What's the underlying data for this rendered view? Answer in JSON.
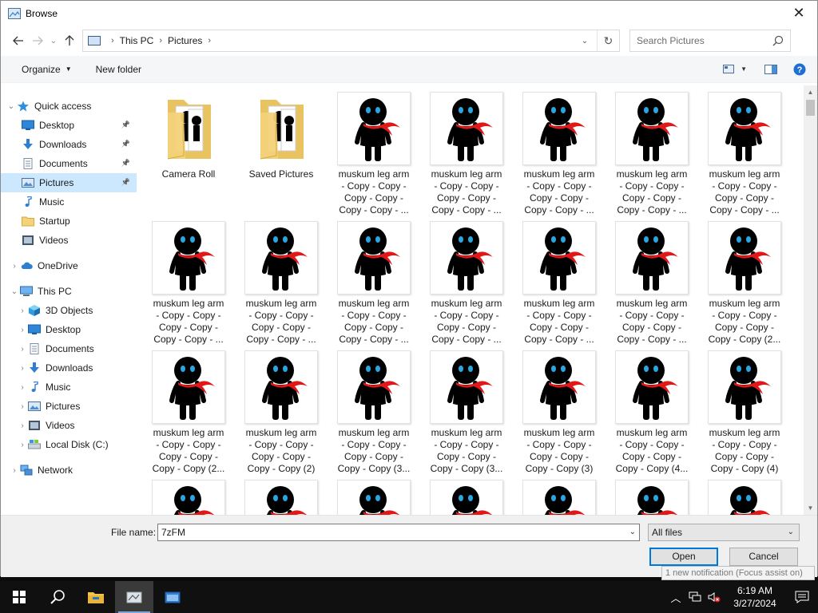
{
  "dialog": {
    "title": "Browse",
    "close_label": "✕"
  },
  "address": {
    "crumbs": [
      "This PC",
      "Pictures"
    ],
    "search_placeholder": "Search Pictures"
  },
  "toolbar": {
    "organize_label": "Organize",
    "new_folder_label": "New folder"
  },
  "nav": {
    "items": [
      {
        "label": "Quick access",
        "icon": "star-icon"
      },
      {
        "label": "Desktop",
        "icon": "desktop-icon"
      },
      {
        "label": "Downloads",
        "icon": "download-icon"
      },
      {
        "label": "Documents",
        "icon": "documents-icon"
      },
      {
        "label": "Pictures",
        "icon": "pictures-icon"
      },
      {
        "label": "Music",
        "icon": "music-icon"
      },
      {
        "label": "Startup",
        "icon": "folder-icon"
      },
      {
        "label": "Videos",
        "icon": "videos-icon"
      },
      {
        "label": "OneDrive",
        "icon": "cloud-icon"
      },
      {
        "label": "This PC",
        "icon": "computer-icon"
      },
      {
        "label": "3D Objects",
        "icon": "cube-icon"
      },
      {
        "label": "Desktop",
        "icon": "desktop-icon"
      },
      {
        "label": "Documents",
        "icon": "documents-icon"
      },
      {
        "label": "Downloads",
        "icon": "download-icon"
      },
      {
        "label": "Music",
        "icon": "music-icon"
      },
      {
        "label": "Pictures",
        "icon": "pictures-icon"
      },
      {
        "label": "Videos",
        "icon": "videos-icon"
      },
      {
        "label": "Local Disk (C:)",
        "icon": "drive-icon"
      },
      {
        "label": "Network",
        "icon": "network-icon"
      }
    ]
  },
  "files": {
    "items": [
      {
        "type": "folder",
        "name": [
          "Camera Roll"
        ]
      },
      {
        "type": "folder",
        "name": [
          "Saved Pictures"
        ]
      },
      {
        "type": "image",
        "name": [
          "muskum leg arm",
          "- Copy - Copy -",
          "Copy - Copy -",
          "Copy - Copy - ..."
        ]
      },
      {
        "type": "image",
        "name": [
          "muskum leg arm",
          "- Copy - Copy -",
          "Copy - Copy -",
          "Copy - Copy - ..."
        ]
      },
      {
        "type": "image",
        "name": [
          "muskum leg arm",
          "- Copy - Copy -",
          "Copy - Copy -",
          "Copy - Copy - ..."
        ]
      },
      {
        "type": "image",
        "name": [
          "muskum leg arm",
          "- Copy - Copy -",
          "Copy - Copy -",
          "Copy - Copy - ..."
        ]
      },
      {
        "type": "image",
        "name": [
          "muskum leg arm",
          "- Copy - Copy -",
          "Copy - Copy -",
          "Copy - Copy - ..."
        ]
      },
      {
        "type": "image",
        "name": [
          "muskum leg arm",
          "- Copy - Copy -",
          "Copy - Copy -",
          "Copy - Copy - ..."
        ]
      },
      {
        "type": "image",
        "name": [
          "muskum leg arm",
          "- Copy - Copy -",
          "Copy - Copy -",
          "Copy - Copy - ..."
        ]
      },
      {
        "type": "image",
        "name": [
          "muskum leg arm",
          "- Copy - Copy -",
          "Copy - Copy -",
          "Copy - Copy - ..."
        ]
      },
      {
        "type": "image",
        "name": [
          "muskum leg arm",
          "- Copy - Copy -",
          "Copy - Copy -",
          "Copy - Copy - ..."
        ]
      },
      {
        "type": "image",
        "name": [
          "muskum leg arm",
          "- Copy - Copy -",
          "Copy - Copy -",
          "Copy - Copy - ..."
        ]
      },
      {
        "type": "image",
        "name": [
          "muskum leg arm",
          "- Copy - Copy -",
          "Copy - Copy -",
          "Copy - Copy - ..."
        ]
      },
      {
        "type": "image",
        "name": [
          "muskum leg arm",
          "- Copy - Copy -",
          "Copy - Copy -",
          "Copy - Copy (2..."
        ]
      },
      {
        "type": "image",
        "name": [
          "muskum leg arm",
          "- Copy - Copy -",
          "Copy - Copy -",
          "Copy - Copy (2..."
        ]
      },
      {
        "type": "image",
        "name": [
          "muskum leg arm",
          "- Copy - Copy -",
          "Copy - Copy -",
          "Copy - Copy (2)"
        ]
      },
      {
        "type": "image",
        "name": [
          "muskum leg arm",
          "- Copy - Copy -",
          "Copy - Copy -",
          "Copy - Copy (3..."
        ]
      },
      {
        "type": "image",
        "name": [
          "muskum leg arm",
          "- Copy - Copy -",
          "Copy - Copy -",
          "Copy - Copy (3..."
        ]
      },
      {
        "type": "image",
        "name": [
          "muskum leg arm",
          "- Copy - Copy -",
          "Copy - Copy -",
          "Copy - Copy (3)"
        ]
      },
      {
        "type": "image",
        "name": [
          "muskum leg arm",
          "- Copy - Copy -",
          "Copy - Copy -",
          "Copy - Copy (4..."
        ]
      },
      {
        "type": "image",
        "name": [
          "muskum leg arm",
          "- Copy - Copy -",
          "Copy - Copy -",
          "Copy - Copy (4)"
        ]
      },
      {
        "type": "image",
        "name": []
      },
      {
        "type": "image",
        "name": []
      },
      {
        "type": "image",
        "name": []
      },
      {
        "type": "image",
        "name": []
      },
      {
        "type": "image",
        "name": []
      },
      {
        "type": "image",
        "name": []
      },
      {
        "type": "image",
        "name": []
      }
    ]
  },
  "bottom": {
    "file_name_label": "File name:",
    "file_name_value": "7zFM",
    "filter_value": "All files",
    "open_label": "Open",
    "cancel_label": "Cancel"
  },
  "notification": "1 new notification (Focus assist on)",
  "taskbar": {
    "time": "6:19 AM",
    "date": "3/27/2024"
  },
  "colors": {
    "selection": "#cce8ff",
    "accent": "#0078d7",
    "figure_eye": "#2aa7e0",
    "figure_scarf": "#e01818",
    "folder": "#f3d27a"
  }
}
